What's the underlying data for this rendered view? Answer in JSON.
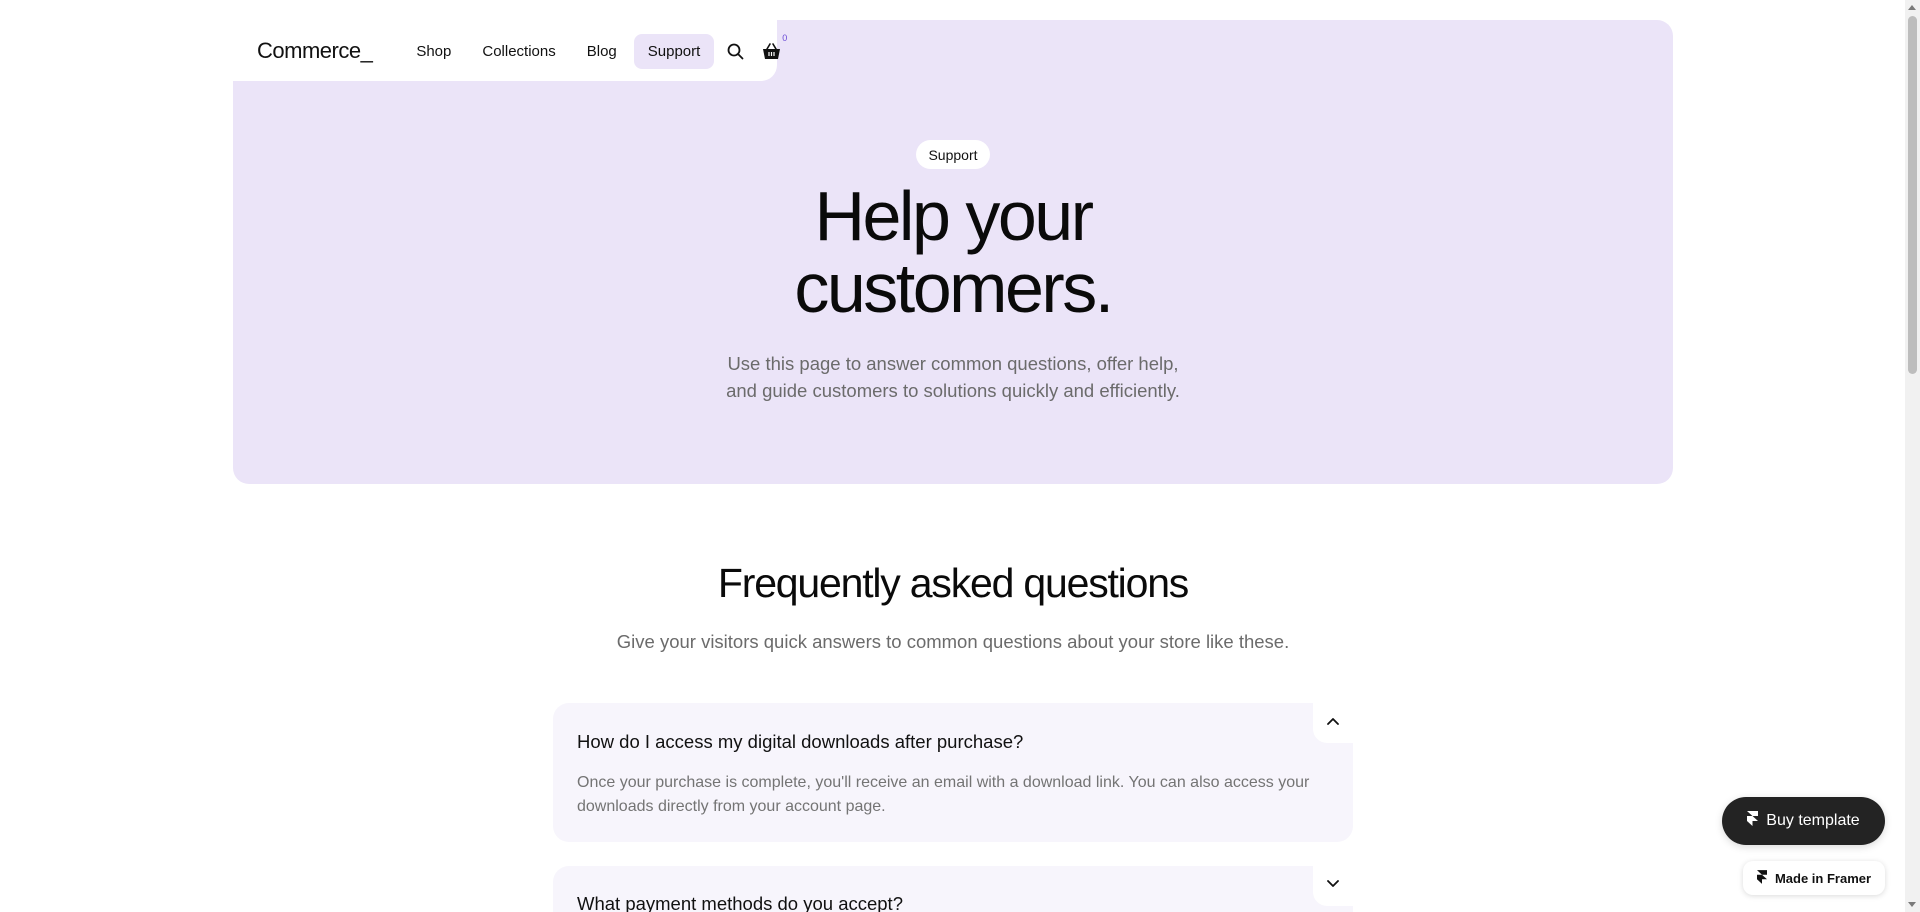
{
  "nav": {
    "logo": "Commerce_",
    "links": [
      "Shop",
      "Collections",
      "Blog",
      "Support"
    ],
    "active_index": 3,
    "cart_count": "0",
    "icons": {
      "search": "search-icon",
      "cart": "basket-icon"
    }
  },
  "hero": {
    "badge": "Support",
    "title_line1": "Help your",
    "title_line2": "customers.",
    "subtitle_line1": "Use this page to answer common questions, offer help,",
    "subtitle_line2": "and guide customers to solutions quickly and efficiently."
  },
  "faq": {
    "title": "Frequently asked questions",
    "subtitle": "Give your visitors quick answers to common questions about your store like these.",
    "items": [
      {
        "question": "How do I access my digital downloads after purchase?",
        "answer_line1": "Once your purchase is complete, you'll receive an email with a download link. You can also access your",
        "answer_line2": "downloads directly from your account page.",
        "expanded": true
      },
      {
        "question": "What payment methods do you accept?",
        "expanded": false
      }
    ]
  },
  "floating": {
    "buy_label": "Buy template",
    "made_label": "Made in Framer"
  },
  "colors": {
    "hero_bg": "#ebe4f8",
    "faq_bg": "#f7f5fc",
    "dark_button": "#232323"
  }
}
